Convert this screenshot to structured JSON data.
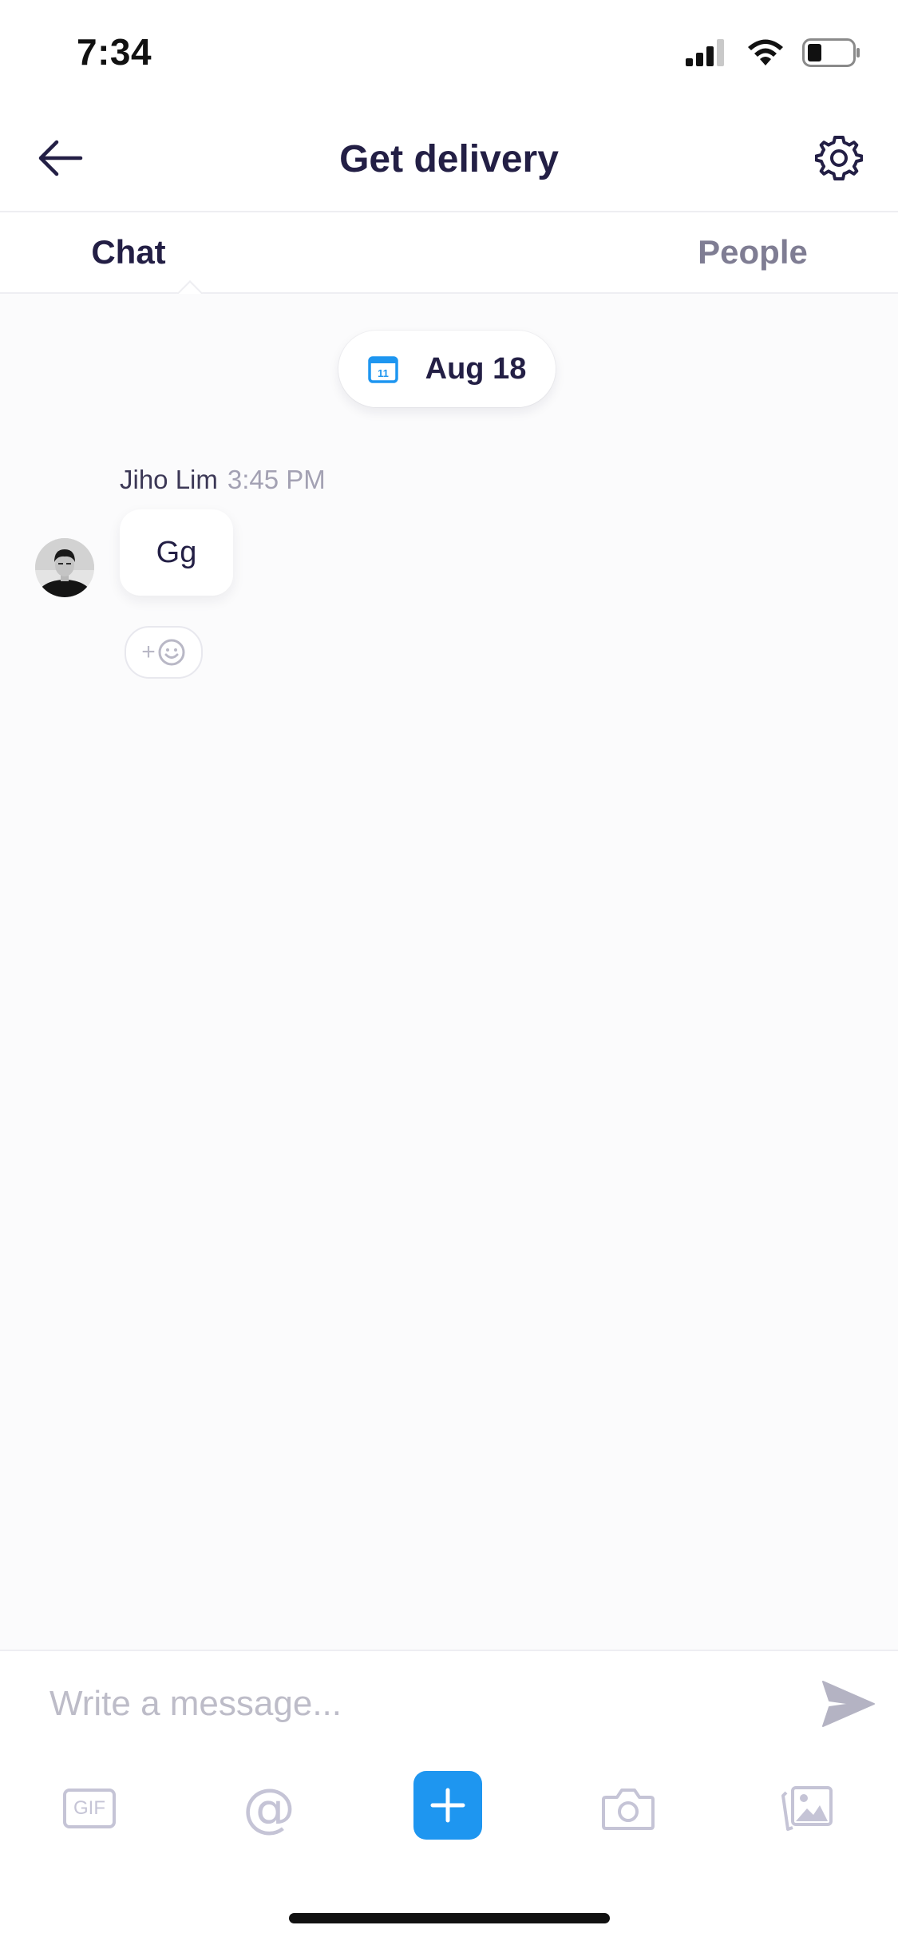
{
  "status_bar": {
    "time": "7:34"
  },
  "header": {
    "title": "Get delivery"
  },
  "tabs": [
    {
      "label": "Chat",
      "active": true
    },
    {
      "label": "People",
      "active": false
    }
  ],
  "date_divider": {
    "calendar_day": "11",
    "label": "Aug 18"
  },
  "messages": [
    {
      "sender": "Jiho Lim",
      "time": "3:45 PM",
      "text": "Gg"
    }
  ],
  "composer": {
    "placeholder": "Write a message...",
    "value": ""
  },
  "toolbar": {
    "gif_label": "GIF",
    "mention_label": "@"
  },
  "colors": {
    "accent": "#1e96f0",
    "title_text": "#231f45",
    "inactive_tab": "#7f7d93",
    "icon_muted": "#c5c4d6"
  },
  "icons": {
    "back": "arrow-left-icon",
    "settings": "gear-icon",
    "calendar": "calendar-icon",
    "reaction": "add-emoji-icon",
    "send": "send-icon",
    "add": "plus-icon",
    "camera": "camera-icon",
    "gallery": "gallery-icon"
  }
}
